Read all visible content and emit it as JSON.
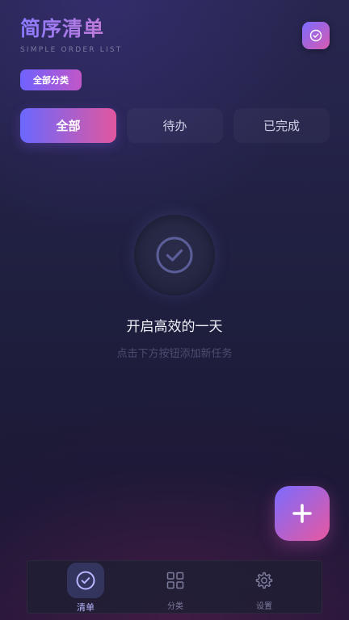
{
  "header": {
    "title": "简序清单",
    "subtitle": "SIMPLE ORDER LIST",
    "action_icon": "check-circle-icon"
  },
  "category": {
    "label": "全部分类"
  },
  "tabs": [
    {
      "label": "全部",
      "active": true
    },
    {
      "label": "待办",
      "active": false
    },
    {
      "label": "已完成",
      "active": false
    }
  ],
  "empty_state": {
    "icon": "check-circle-icon",
    "title": "开启高效的一天",
    "hint": "点击下方按钮添加新任务"
  },
  "fab": {
    "icon": "plus-icon"
  },
  "bottom_nav": [
    {
      "label": "清单",
      "icon": "check-circle-icon",
      "active": true
    },
    {
      "label": "分类",
      "icon": "grid-icon",
      "active": false
    },
    {
      "label": "设置",
      "icon": "gear-icon",
      "active": false
    }
  ],
  "colors": {
    "accent_start": "#6a68ff",
    "accent_end": "#e2579f",
    "background": "#1f1f40"
  }
}
